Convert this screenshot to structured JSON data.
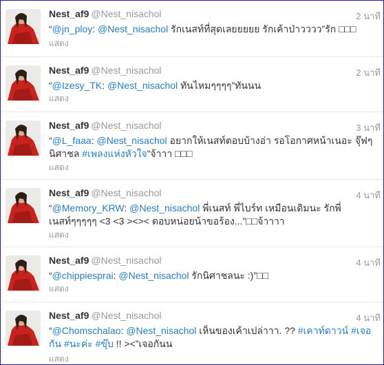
{
  "accent_color": "#2b7bb9",
  "tweets": [
    {
      "fullname": "Nest_af9",
      "username": "@Nest_nisachol",
      "time": "2 นาที",
      "segments": [
        {
          "t": "“",
          "link": false
        },
        {
          "t": "@jn_ploy",
          "link": true
        },
        {
          "t": ": ",
          "link": false
        },
        {
          "t": "@Nest_nisachol",
          "link": true
        },
        {
          "t": " รักเนสท์ที่สุดเลยยยยย รักเค้าป่าวววว”รัก □□□",
          "link": false
        }
      ],
      "expand": "แสดง"
    },
    {
      "fullname": "Nest_af9",
      "username": "@Nest_nisachol",
      "time": "2 นาที",
      "segments": [
        {
          "t": "“",
          "link": false
        },
        {
          "t": "@Izesy_TK",
          "link": true
        },
        {
          "t": ": ",
          "link": false
        },
        {
          "t": "@Nest_nisachol",
          "link": true
        },
        {
          "t": " ทันไหมๆๆๆๆ”ทันนน",
          "link": false
        }
      ],
      "expand": "แสดง"
    },
    {
      "fullname": "Nest_af9",
      "username": "@Nest_nisachol",
      "time": "3 นาที",
      "segments": [
        {
          "t": "“",
          "link": false
        },
        {
          "t": "@L_faaa",
          "link": true
        },
        {
          "t": ": ",
          "link": false
        },
        {
          "t": "@Nest_nisachol",
          "link": true
        },
        {
          "t": " อยากให้เนสท์ตอบบ้างอ่า รอโอกาศหน้าเนอะ จุ๊ฟๆ นิศาชล ",
          "link": false
        },
        {
          "t": "#เพลงแห่งหัวใจ",
          "link": true
        },
        {
          "t": "”จ้าาา □□□",
          "link": false
        }
      ],
      "expand": "แสดง"
    },
    {
      "fullname": "Nest_af9",
      "username": "@Nest_nisachol",
      "time": "4 นาที",
      "segments": [
        {
          "t": "“",
          "link": false
        },
        {
          "t": "@Memory_KRW",
          "link": true
        },
        {
          "t": ": ",
          "link": false
        },
        {
          "t": "@Nest_nisachol",
          "link": true
        },
        {
          "t": " พี่เนสท์ พี่ไบร์ท เหมือนเดิมนะ รักพี่เนสท์ๆๆๆๆๆ <3 <3 ><>< ตอบหน่อยน้าขอร้อง...”□□จ้าาาา",
          "link": false
        }
      ],
      "expand": "แสดง"
    },
    {
      "fullname": "Nest_af9",
      "username": "@Nest_nisachol",
      "time": "4 นาที",
      "segments": [
        {
          "t": "“",
          "link": false
        },
        {
          "t": "@chippiesprai",
          "link": true
        },
        {
          "t": ": ",
          "link": false
        },
        {
          "t": "@Nest_nisachol",
          "link": true
        },
        {
          "t": " รักนิศาชลนะ :)”□□",
          "link": false
        }
      ],
      "expand": "แสดง"
    },
    {
      "fullname": "Nest_af9",
      "username": "@Nest_nisachol",
      "time": "4 นาที",
      "segments": [
        {
          "t": "“",
          "link": false
        },
        {
          "t": "@Chomschalao",
          "link": true
        },
        {
          "t": ": ",
          "link": false
        },
        {
          "t": "@Nest_nisachol",
          "link": true
        },
        {
          "t": " เห็นของเค้าเปล่าาา. ?? ",
          "link": false
        },
        {
          "t": "#เคาท์ดาวน์",
          "link": true
        },
        {
          "t": " ",
          "link": false
        },
        {
          "t": "#เจอกัน",
          "link": true
        },
        {
          "t": " ",
          "link": false
        },
        {
          "t": "#นะค่ะ",
          "link": true
        },
        {
          "t": " ",
          "link": false
        },
        {
          "t": "#ขุ๊บ",
          "link": true
        },
        {
          "t": " !! ><”เจอกันน",
          "link": false
        }
      ],
      "expand": "แสดง"
    }
  ]
}
